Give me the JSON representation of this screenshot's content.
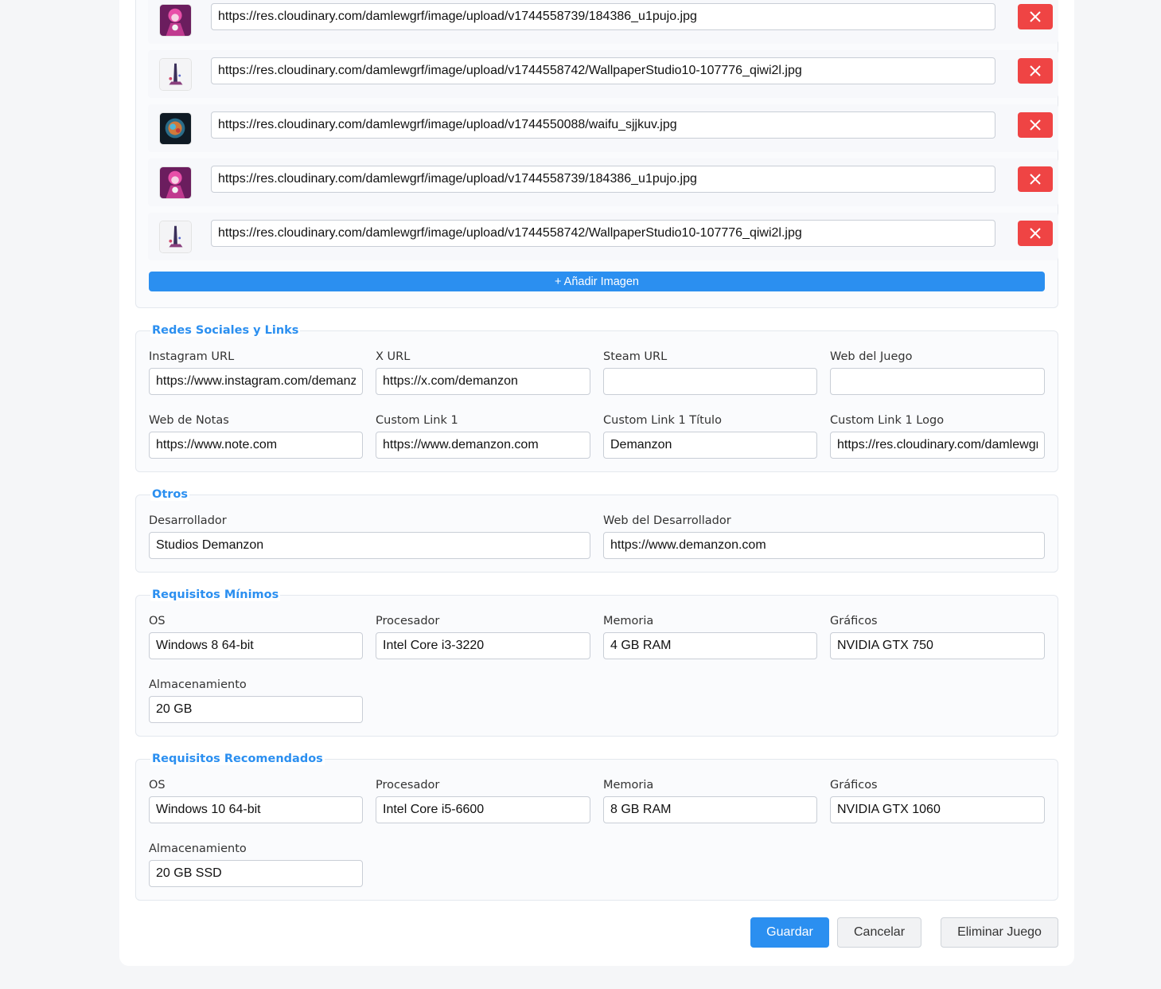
{
  "colors": {
    "accent": "#2b8ff0",
    "danger": "#ef4444",
    "background": "#f5f6f8"
  },
  "gallery": {
    "images": [
      {
        "url": "https://res.cloudinary.com/damlewgrf/image/upload/v1744558739/184386_u1pujo.jpg",
        "thumb_icon": "anime-girl-pink-thumbnail"
      },
      {
        "url": "https://res.cloudinary.com/damlewgrf/image/upload/v1744558742/WallpaperStudio10-107776_qiwi2l.jpg",
        "thumb_icon": "figure-wallpaper-thumbnail"
      },
      {
        "url": "https://res.cloudinary.com/damlewgrf/image/upload/v1744550088/waifu_sjjkuv.jpg",
        "thumb_icon": "dark-orb-thumbnail"
      },
      {
        "url": "https://res.cloudinary.com/damlewgrf/image/upload/v1744558739/184386_u1pujo.jpg",
        "thumb_icon": "anime-girl-pink-thumbnail"
      },
      {
        "url": "https://res.cloudinary.com/damlewgrf/image/upload/v1744558742/WallpaperStudio10-107776_qiwi2l.jpg",
        "thumb_icon": "figure-wallpaper-thumbnail"
      }
    ],
    "delete_icon": "close-x-icon",
    "add_label": "+ Añadir Imagen"
  },
  "social": {
    "title": "Redes Sociales y Links",
    "instagram": {
      "label": "Instagram URL",
      "value": "https://www.instagram.com/demanzon"
    },
    "x": {
      "label": "X URL",
      "value": "https://x.com/demanzon"
    },
    "steam": {
      "label": "Steam URL",
      "value": ""
    },
    "web_game": {
      "label": "Web del Juego",
      "value": ""
    },
    "web_notes": {
      "label": "Web de Notas",
      "value": "https://www.note.com"
    },
    "custom_link_1": {
      "label": "Custom Link 1",
      "value": "https://www.demanzon.com"
    },
    "custom_link_1_title": {
      "label": "Custom Link 1 Título",
      "value": "Demanzon"
    },
    "custom_link_1_logo": {
      "label": "Custom Link 1 Logo",
      "value": "https://res.cloudinary.com/damlewgrf"
    }
  },
  "others": {
    "title": "Otros",
    "developer": {
      "label": "Desarrollador",
      "value": "Studios Demanzon"
    },
    "developer_web": {
      "label": "Web del Desarrollador",
      "value": "https://www.demanzon.com"
    }
  },
  "min_req": {
    "title": "Requisitos Mínimos",
    "os": {
      "label": "OS",
      "value": "Windows 8 64-bit"
    },
    "cpu": {
      "label": "Procesador",
      "value": "Intel Core i3-3220"
    },
    "memory": {
      "label": "Memoria",
      "value": "4 GB RAM"
    },
    "graphics": {
      "label": "Gráficos",
      "value": "NVIDIA GTX 750"
    },
    "storage": {
      "label": "Almacenamiento",
      "value": "20 GB"
    }
  },
  "rec_req": {
    "title": "Requisitos Recomendados",
    "os": {
      "label": "OS",
      "value": "Windows 10 64-bit"
    },
    "cpu": {
      "label": "Procesador",
      "value": "Intel Core i5-6600"
    },
    "memory": {
      "label": "Memoria",
      "value": "8 GB RAM"
    },
    "graphics": {
      "label": "Gráficos",
      "value": "NVIDIA GTX 1060"
    },
    "storage": {
      "label": "Almacenamiento",
      "value": "20 GB SSD"
    }
  },
  "actions": {
    "save": "Guardar",
    "cancel": "Cancelar",
    "delete": "Eliminar Juego"
  }
}
